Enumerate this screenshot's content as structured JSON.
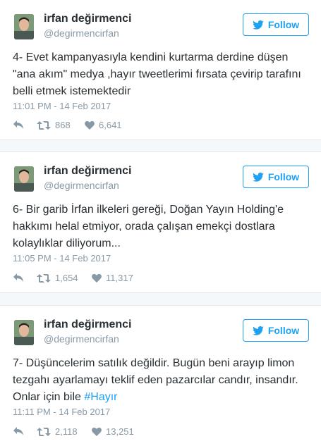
{
  "tweets": [
    {
      "name": "irfan değirmenci",
      "handle": "@degirmencirfan",
      "follow_label": "Follow",
      "text": "4- Evet kampanyasıyla kendini kurtarma derdine düşen \"ana akım\" medya ,hayır tweetlerimi fırsata çevirip tarafını belli etmek istemektedir",
      "hashtag": "",
      "time": "11:01 PM - 14 Feb 2017",
      "retweets": "868",
      "likes": "6,641"
    },
    {
      "name": "irfan değirmenci",
      "handle": "@degirmencirfan",
      "follow_label": "Follow",
      "text": "6- Bir garib İrfan ilkeleri gereği, Doğan Yayın Holding'e hakkımı helal etmiyor, orada çalışan emekçi dostlara kolaylıklar diliyorum...",
      "hashtag": "",
      "time": "11:05 PM - 14 Feb 2017",
      "retweets": "1,654",
      "likes": "11,317"
    },
    {
      "name": "irfan değirmenci",
      "handle": "@degirmencirfan",
      "follow_label": "Follow",
      "text": "7- Düşüncelerim satılık değildir. Bugün beni arayıp limon tezgahı ayarlamayı teklif eden pazarcılar candır, insandır. Onlar için bile ",
      "hashtag": "#Hayır",
      "time": "11:11 PM - 14 Feb 2017",
      "retweets": "2,118",
      "likes": "13,251"
    }
  ],
  "colors": {
    "accent": "#1da1f2",
    "muted": "#8899a6",
    "text": "#292f33",
    "separator": "#f5f8fa"
  },
  "icons": {
    "reply": "reply-icon",
    "retweet": "retweet-icon",
    "like": "heart-icon",
    "follow": "twitter-bird-icon"
  }
}
